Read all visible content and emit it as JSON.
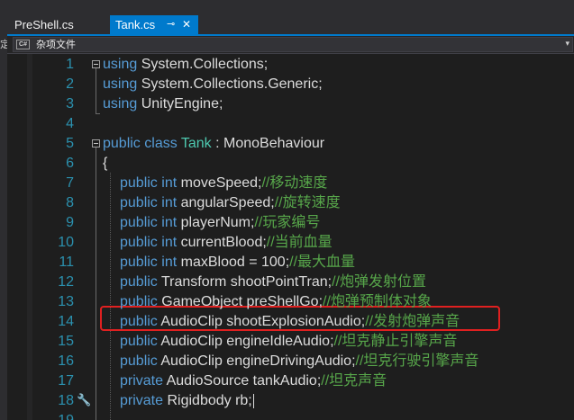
{
  "tabs": [
    {
      "label": "PreShell.cs",
      "active": false
    },
    {
      "label": "Tank.cs",
      "active": true,
      "pin_icon": "⊸",
      "close_icon": "✕"
    }
  ],
  "left_edge_glyph": "定",
  "navbar": {
    "project_icon_text": "C#",
    "project_label": "杂项文件",
    "chevron": "▾"
  },
  "code_lines": [
    {
      "num": "1",
      "fold": "start",
      "tokens": [
        {
          "t": "using",
          "c": "kw"
        },
        {
          "t": " System.Collections;",
          "c": ""
        }
      ]
    },
    {
      "num": "2",
      "tokens": [
        {
          "t": "using",
          "c": "kw"
        },
        {
          "t": " System.Collections.Generic;",
          "c": ""
        }
      ]
    },
    {
      "num": "3",
      "tokens": [
        {
          "t": "using",
          "c": "kw"
        },
        {
          "t": " UnityEngine;",
          "c": ""
        }
      ]
    },
    {
      "num": "4",
      "tokens": []
    },
    {
      "num": "5",
      "fold": "start",
      "tokens": [
        {
          "t": "public",
          "c": "kw"
        },
        {
          "t": " ",
          "c": ""
        },
        {
          "t": "class",
          "c": "kw"
        },
        {
          "t": " ",
          "c": ""
        },
        {
          "t": "Tank",
          "c": "ty"
        },
        {
          "t": " : MonoBehaviour",
          "c": ""
        }
      ]
    },
    {
      "num": "6",
      "tokens": [
        {
          "t": "{",
          "c": ""
        }
      ]
    },
    {
      "num": "7",
      "indent": true,
      "tokens": [
        {
          "t": "public",
          "c": "kw"
        },
        {
          "t": " ",
          "c": ""
        },
        {
          "t": "int",
          "c": "kw"
        },
        {
          "t": " moveSpeed;",
          "c": ""
        },
        {
          "t": "//移动速度",
          "c": "cm"
        }
      ]
    },
    {
      "num": "8",
      "indent": true,
      "tokens": [
        {
          "t": "public",
          "c": "kw"
        },
        {
          "t": " ",
          "c": ""
        },
        {
          "t": "int",
          "c": "kw"
        },
        {
          "t": " angularSpeed;",
          "c": ""
        },
        {
          "t": "//旋转速度",
          "c": "cm"
        }
      ]
    },
    {
      "num": "9",
      "indent": true,
      "tokens": [
        {
          "t": "public",
          "c": "kw"
        },
        {
          "t": " ",
          "c": ""
        },
        {
          "t": "int",
          "c": "kw"
        },
        {
          "t": " playerNum;",
          "c": ""
        },
        {
          "t": "//玩家编号",
          "c": "cm"
        }
      ]
    },
    {
      "num": "10",
      "indent": true,
      "tokens": [
        {
          "t": "public",
          "c": "kw"
        },
        {
          "t": " ",
          "c": ""
        },
        {
          "t": "int",
          "c": "kw"
        },
        {
          "t": " currentBlood;",
          "c": ""
        },
        {
          "t": "//当前血量",
          "c": "cm"
        }
      ]
    },
    {
      "num": "11",
      "indent": true,
      "tokens": [
        {
          "t": "public",
          "c": "kw"
        },
        {
          "t": " ",
          "c": ""
        },
        {
          "t": "int",
          "c": "kw"
        },
        {
          "t": " maxBlood = 100;",
          "c": ""
        },
        {
          "t": "//最大血量",
          "c": "cm"
        }
      ]
    },
    {
      "num": "12",
      "indent": true,
      "tokens": [
        {
          "t": "public",
          "c": "kw"
        },
        {
          "t": " Transform shootPointTran;",
          "c": ""
        },
        {
          "t": "//炮弹发射位置",
          "c": "cm"
        }
      ]
    },
    {
      "num": "13",
      "indent": true,
      "tokens": [
        {
          "t": "public",
          "c": "kw"
        },
        {
          "t": " GameObject preShellGo;",
          "c": ""
        },
        {
          "t": "//炮弹预制体对象",
          "c": "cm"
        }
      ]
    },
    {
      "num": "14",
      "indent": true,
      "tokens": [
        {
          "t": "public",
          "c": "kw"
        },
        {
          "t": " AudioClip shootExplosionAudio;",
          "c": ""
        },
        {
          "t": "//发射炮弹声音",
          "c": "cm"
        }
      ]
    },
    {
      "num": "15",
      "indent": true,
      "tokens": [
        {
          "t": "public",
          "c": "kw"
        },
        {
          "t": " AudioClip engineIdleAudio;",
          "c": ""
        },
        {
          "t": "//坦克静止引擎声音",
          "c": "cm"
        }
      ]
    },
    {
      "num": "16",
      "indent": true,
      "tokens": [
        {
          "t": "public",
          "c": "kw"
        },
        {
          "t": " AudioClip engineDrivingAudio;",
          "c": ""
        },
        {
          "t": "//坦克行驶引擎声音",
          "c": "cm"
        }
      ]
    },
    {
      "num": "17",
      "indent": true,
      "tokens": [
        {
          "t": "private",
          "c": "kw"
        },
        {
          "t": " AudioSource tankAudio;",
          "c": ""
        },
        {
          "t": "//坦克声音",
          "c": "cm"
        }
      ]
    },
    {
      "num": "18",
      "indent": true,
      "wrench": true,
      "caret": true,
      "tokens": [
        {
          "t": "private",
          "c": "kw"
        },
        {
          "t": " Rigidbody rb;",
          "c": ""
        }
      ]
    },
    {
      "num": "19",
      "tokens": []
    }
  ],
  "highlighted_line": "14",
  "colors": {
    "keyword": "#569cd6",
    "type": "#4ec9b0",
    "comment": "#57a64a",
    "line_number": "#2b91af",
    "highlight_box": "#e02020",
    "active_tab": "#007acc"
  }
}
